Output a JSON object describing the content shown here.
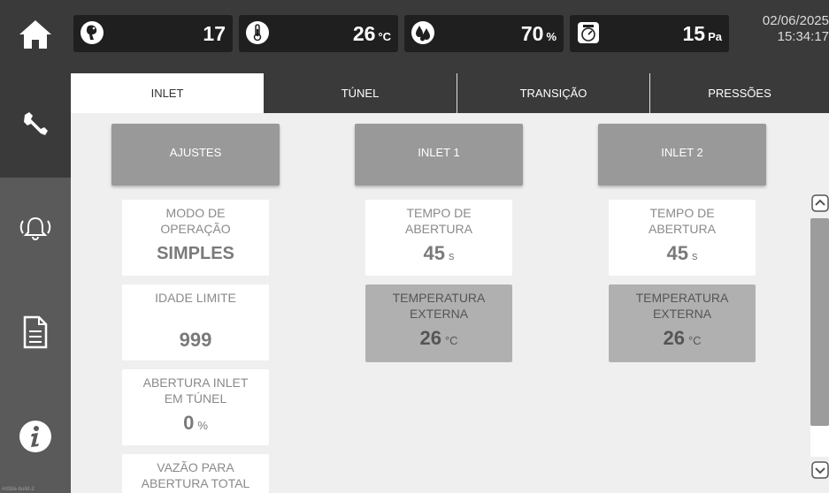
{
  "topbar": {
    "stats": [
      {
        "icon": "chicken-icon",
        "value": "17",
        "unit": ""
      },
      {
        "icon": "thermometer-icon",
        "value": "26",
        "unit": "°C"
      },
      {
        "icon": "humidity-icon",
        "value": "70",
        "unit": "%"
      },
      {
        "icon": "pressure-gauge-icon",
        "value": "15",
        "unit": "Pa"
      }
    ],
    "date": "02/06/2025",
    "time": "15:34:17"
  },
  "sidebar": {
    "items": [
      "wrench-icon",
      "alarm-bell-icon",
      "document-icon",
      "info-icon"
    ],
    "build": "#d3de-build-2"
  },
  "tabs": [
    "INLET",
    "TÚNEL",
    "TRANSIÇÃO",
    "PRESSÕES"
  ],
  "buttons": {
    "ajustes": "AJUSTES",
    "inlet1": "INLET 1",
    "inlet2": "INLET 2"
  },
  "ajustes": {
    "modo_label": "MODO DE\nOPERAÇÃO",
    "modo_value": "SIMPLES",
    "idade_label": "IDADE LIMITE",
    "idade_value": "999",
    "abertura_label": "ABERTURA INLET\nEM TÚNEL",
    "abertura_value": "0",
    "abertura_unit": "%",
    "vazao_label": "VAZÃO PARA\nABERTURA TOTAL"
  },
  "inlet1": {
    "tempo_label": "TEMPO DE\nABERTURA",
    "tempo_value": "45",
    "tempo_unit": "s",
    "temp_label": "TEMPERATURA\nEXTERNA",
    "temp_value": "26",
    "temp_unit": "°C"
  },
  "inlet2": {
    "tempo_label": "TEMPO DE\nABERTURA",
    "tempo_value": "45",
    "tempo_unit": "s",
    "temp_label": "TEMPERATURA\nEXTERNA",
    "temp_value": "26",
    "temp_unit": "°C"
  },
  "colors": {
    "topbar": "#3a3a3a",
    "sidebar": "#5a5a5a",
    "button": "#999999",
    "background": "#efefef"
  }
}
